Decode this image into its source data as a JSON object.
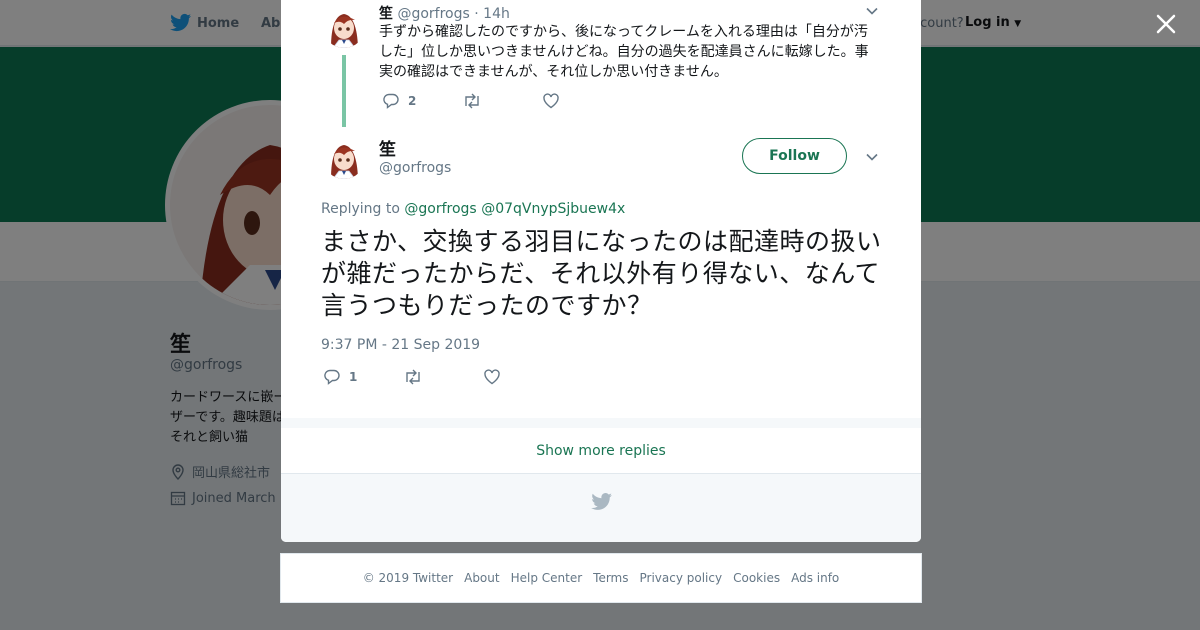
{
  "nav": {
    "home": "Home",
    "about": "Abo",
    "account": "account?",
    "login": "Log in"
  },
  "profile": {
    "name": "笙",
    "handle": "@gorfrogs",
    "bio": "カードワースに嵌ーザーです。趣味題はそれと飼い猫",
    "location": "岡山県総社市",
    "joined": "Joined March"
  },
  "reply_tweet": {
    "name": "笙",
    "handle": "@gorfrogs",
    "dot": "·",
    "time": "14h",
    "text": "手ずから確認したのですから、後になってクレームを入れる理由は「自分が汚した」位しか思いつきませんけどね。自分の過失を配達員さんに転嫁した。事実の確認はできませんが、それ位しか思い付きません。",
    "reply_count": "2"
  },
  "main_tweet": {
    "name": "笙",
    "handle": "@gorfrogs",
    "follow_label": "Follow",
    "replying_prefix": "Replying to",
    "mention1": "@gorfrogs",
    "mention2": "@07qVnypSjbuew4x",
    "text": "まさか、交換する羽目になったのは配達時の扱いが雑だったからだ、それ以外有り得ない、なんて言うつもりだったのですか？",
    "timestamp": "9:37 PM - 21 Sep 2019",
    "reply_count": "1"
  },
  "show_more": "Show more replies",
  "footer": {
    "links": [
      "© 2019 Twitter",
      "About",
      "Help Center",
      "Terms",
      "Privacy policy",
      "Cookies",
      "Ads info"
    ]
  },
  "colors": {
    "accent": "#1a7553",
    "banner": "#0d7a54",
    "thread": "#7ac5a5"
  },
  "icons": [
    "twitter-bird-icon",
    "reply-icon",
    "retweet-icon",
    "like-icon",
    "chevron-down-icon",
    "close-icon",
    "location-icon",
    "calendar-icon"
  ]
}
